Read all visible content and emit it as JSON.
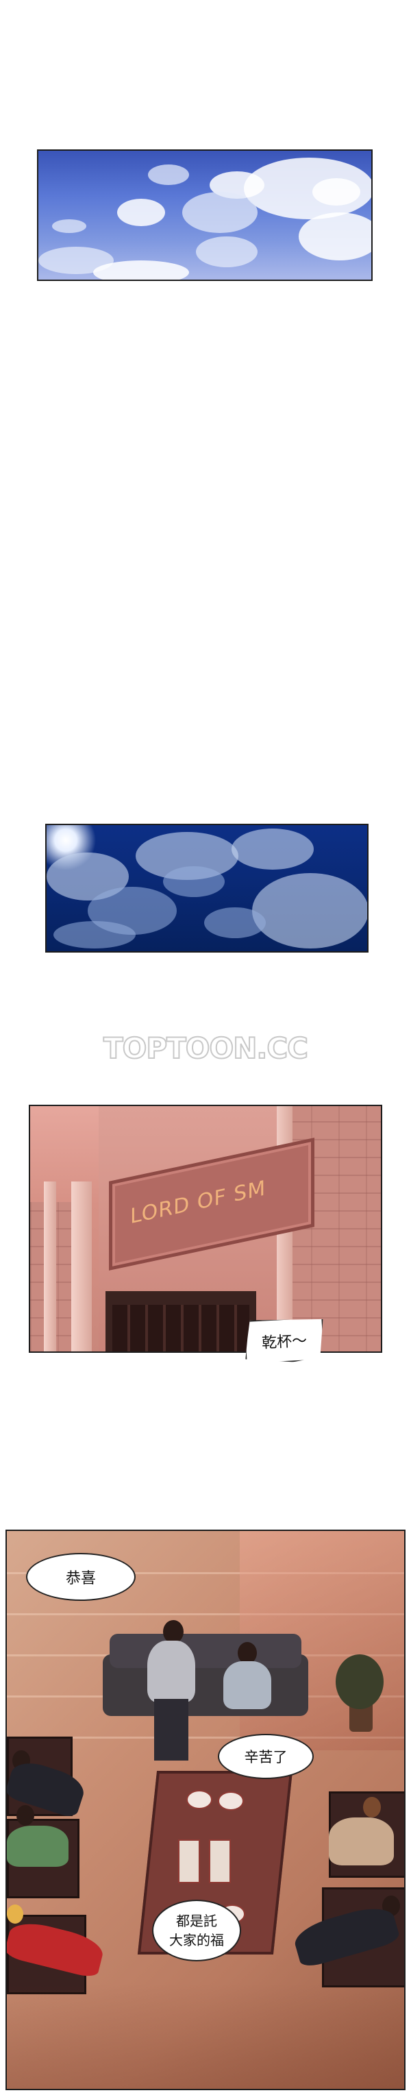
{
  "watermark": "TOPTOON.CC",
  "sign_text": "LORD OF SM",
  "bubbles": {
    "cheers": "乾杯～",
    "congrats": "恭喜",
    "good_work": "辛苦了",
    "thanks_line1": "都是託",
    "thanks_line2": "大家的福"
  }
}
